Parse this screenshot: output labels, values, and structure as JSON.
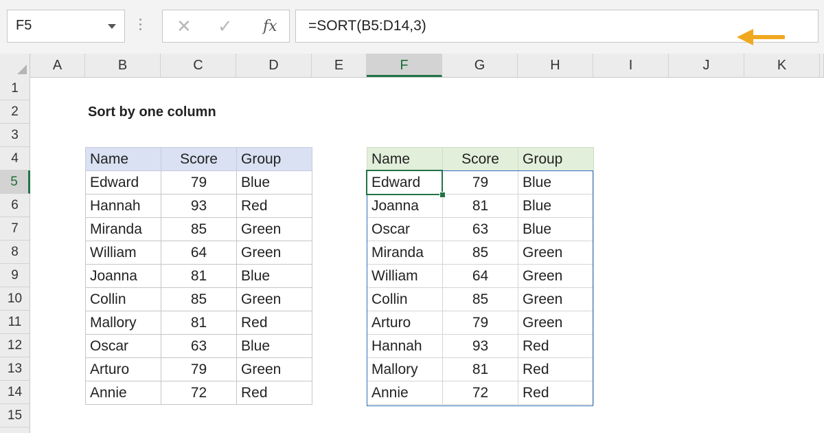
{
  "name_box": {
    "value": "F5"
  },
  "formula_bar": {
    "cancel_icon": "x-icon",
    "enter_icon": "check-icon",
    "insert_function_label": "fx",
    "formula": "=SORT(B5:D14,3)",
    "arrow_color": "#f0a820"
  },
  "columns": [
    "A",
    "B",
    "C",
    "D",
    "E",
    "F",
    "G",
    "H",
    "I",
    "J",
    "K"
  ],
  "active_column": "F",
  "rows": [
    "1",
    "2",
    "3",
    "4",
    "5",
    "6",
    "7",
    "8",
    "9",
    "10",
    "11",
    "12",
    "13",
    "14",
    "15"
  ],
  "active_row": "5",
  "sheet_title": "Sort by one column",
  "source_table": {
    "headers": [
      "Name",
      "Score",
      "Group"
    ],
    "rows": [
      [
        "Edward",
        "79",
        "Blue"
      ],
      [
        "Hannah",
        "93",
        "Red"
      ],
      [
        "Miranda",
        "85",
        "Green"
      ],
      [
        "William",
        "64",
        "Green"
      ],
      [
        "Joanna",
        "81",
        "Blue"
      ],
      [
        "Collin",
        "85",
        "Green"
      ],
      [
        "Mallory",
        "81",
        "Red"
      ],
      [
        "Oscar",
        "63",
        "Blue"
      ],
      [
        "Arturo",
        "79",
        "Green"
      ],
      [
        "Annie",
        "72",
        "Red"
      ]
    ]
  },
  "result_table": {
    "headers": [
      "Name",
      "Score",
      "Group"
    ],
    "rows": [
      [
        "Edward",
        "79",
        "Blue"
      ],
      [
        "Joanna",
        "81",
        "Blue"
      ],
      [
        "Oscar",
        "63",
        "Blue"
      ],
      [
        "Miranda",
        "85",
        "Green"
      ],
      [
        "William",
        "64",
        "Green"
      ],
      [
        "Collin",
        "85",
        "Green"
      ],
      [
        "Arturo",
        "79",
        "Green"
      ],
      [
        "Hannah",
        "93",
        "Red"
      ],
      [
        "Mallory",
        "81",
        "Red"
      ],
      [
        "Annie",
        "72",
        "Red"
      ]
    ]
  },
  "colors": {
    "source_header_fill": "#d9e1f2",
    "result_header_fill": "#e2efda",
    "active_cell_border": "#217346",
    "spill_border": "#2f6cc0"
  }
}
